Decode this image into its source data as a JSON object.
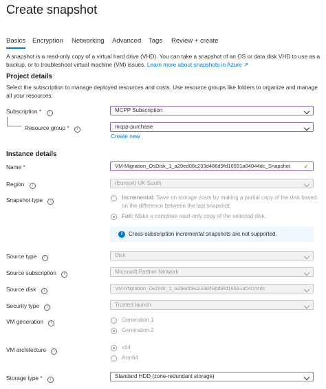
{
  "header": {
    "title": "Create snapshot",
    "more": "···"
  },
  "tabs": [
    "Basics",
    "Encryption",
    "Networking",
    "Advanced",
    "Tags",
    "Review + create"
  ],
  "intro": {
    "text": "A snapshot is a read-only copy of a virtual hard drive (VHD). You can take a snapshot of an OS or data disk VHD to use as a backup, or to troubleshoot virtual machine (VM) issues.",
    "link": "Learn more about snapshots in Azure ↗"
  },
  "project": {
    "heading": "Project details",
    "description": "Select the subscription to manage deployed resources and costs. Use resource groups like folders to organize and manage all your resources.",
    "subscription_label": "Subscription",
    "subscription_value": "MCPP Subscription",
    "rg_label": "Resource group",
    "rg_value": "mcpp-purchase",
    "create_new": "Create new"
  },
  "instance": {
    "heading": "Instance details",
    "name_label": "Name",
    "name_value": "VM-Migration_OsDisk_1_a29ed08c233d486d9fd16591a04044dc_Snapshot",
    "region_label": "Region",
    "region_value": "(Europe) UK South",
    "snapshot_type_label": "Snapshot type",
    "incremental_title": "Incremental:",
    "incremental_desc": "Save on storage costs by making a partial copy of the disk based on the difference between the last snapshot.",
    "full_title": "Full:",
    "full_desc": "Make a complete read-only copy of the selected disk.",
    "info_message": "Cross-subscription incremental snapshots are not supported.",
    "source_type_label": "Source type",
    "source_type_value": "Disk",
    "source_sub_label": "Source subscription",
    "source_sub_value": "Microsoft Partner Network",
    "source_disk_label": "Source disk",
    "source_disk_value": "VM-Migration_OsDisk_1_a29ed08c233d486d9fd16591a04044dc",
    "security_label": "Security type",
    "security_value": "Trusted launch",
    "vmgen_label": "VM generation",
    "gen1": "Generation 1",
    "gen2": "Generation 2",
    "arch_label": "VM architecture",
    "x64": "x64",
    "arm64": "Arm64",
    "storage_label": "Storage type",
    "storage_value": "Standard HDD (zone-redundant storage)"
  },
  "required_mark": "*",
  "info_glyph": "i",
  "colors": {
    "accent": "#0078d4",
    "focus_border": "#8764b8",
    "required": "#a4262c",
    "valid": "#57a300"
  }
}
